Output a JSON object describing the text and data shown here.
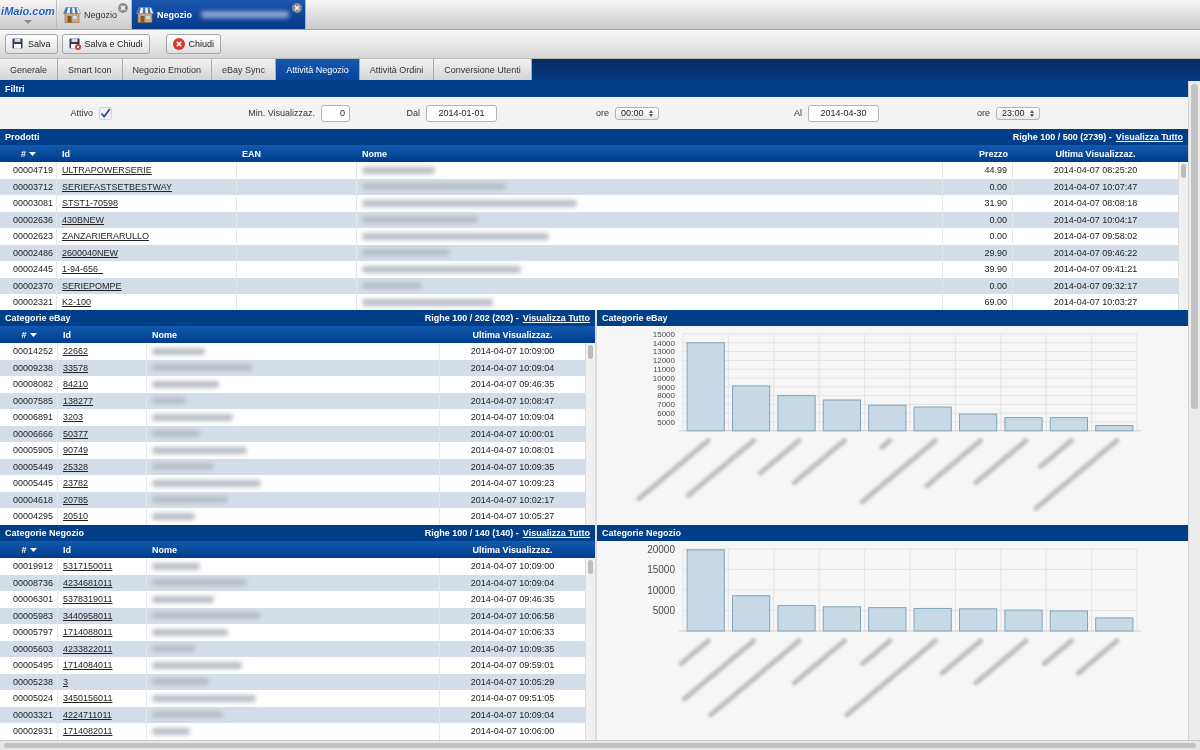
{
  "header": {
    "logo": "iMaio.com",
    "tabs": [
      {
        "label": "Negozio",
        "selected": false,
        "name_blurred": false
      },
      {
        "label": "Negozio",
        "selected": true,
        "name_blurred": true
      }
    ]
  },
  "toolbar": [
    {
      "label": "Salva",
      "kind": "save"
    },
    {
      "label": "Salva e Chiudi",
      "kind": "save_close"
    },
    {
      "label": "Chiudi",
      "kind": "close"
    }
  ],
  "tabs": [
    {
      "label": "Generale",
      "selected": false
    },
    {
      "label": "Smart Icon",
      "selected": false
    },
    {
      "label": "Negozio Emotion",
      "selected": false
    },
    {
      "label": "eBay Sync",
      "selected": false
    },
    {
      "label": "Attività Negozio",
      "selected": true
    },
    {
      "label": "Attività Ordini",
      "selected": false
    },
    {
      "label": "Conversione Utenti",
      "selected": false
    }
  ],
  "filters": {
    "title": "Filtri",
    "fields": [
      {
        "kind": "checkbox",
        "label": "Attivo",
        "checked": true
      },
      {
        "kind": "number",
        "label": "Min. Visualizzaz.",
        "value": "0"
      },
      {
        "kind": "date",
        "label": "Dal",
        "value": "2014-01-01"
      },
      {
        "kind": "select",
        "label": "ore",
        "value": "00:00"
      },
      {
        "kind": "date",
        "label": "Al",
        "value": "2014-04-30"
      },
      {
        "kind": "select",
        "label": "ore",
        "value": "23:00"
      }
    ]
  },
  "products": {
    "title": "Prodotti",
    "summary": "Righe 100 / 500 (2739) -",
    "show_all": "Visualizza Tutto",
    "columns": [
      {
        "label": "#",
        "kind": "number",
        "sorted": true
      },
      {
        "label": "Id",
        "kind": "id",
        "sorted": false
      },
      {
        "label": "EAN",
        "kind": "ean",
        "sorted": false
      },
      {
        "label": "Nome",
        "kind": "name",
        "sorted": false
      },
      {
        "label": "Prezzo",
        "kind": "price",
        "sorted": false
      },
      {
        "label": "Ultima Visualizzaz.",
        "kind": "date",
        "sorted": false
      }
    ],
    "rows": [
      {
        "number": "00004719",
        "id": "ULTRAPOWERSERIE",
        "price": "44.99",
        "last_view": "2014-04-07 08:25:20"
      },
      {
        "number": "00003712",
        "id": "SERIEFASTSETBESTWAY",
        "price": "0.00",
        "last_view": "2014-04-07 10:07:47"
      },
      {
        "number": "00003081",
        "id": "STST1-70598",
        "price": "31.90",
        "last_view": "2014-04-07 08:08:18"
      },
      {
        "number": "00002636",
        "id": "430BNEW",
        "price": "0.00",
        "last_view": "2014-04-07 10:04:17"
      },
      {
        "number": "00002623",
        "id": "ZANZARIERARULLO",
        "price": "0.00",
        "last_view": "2014-04-07 09:58:02"
      },
      {
        "number": "00002486",
        "id": "2600040NEW",
        "price": "29.90",
        "last_view": "2014-04-07 09:46:22"
      },
      {
        "number": "00002445",
        "id": "1-94-656_",
        "price": "39.90",
        "last_view": "2014-04-07 09:41:21"
      },
      {
        "number": "00002370",
        "id": "SERIEPOMPE",
        "price": "0.00",
        "last_view": "2014-04-07 09:32:17"
      },
      {
        "number": "00002321",
        "id": "K2-100",
        "price": "69.00",
        "last_view": "2014-04-07 10:03:27"
      }
    ]
  },
  "category_panels": [
    {
      "table": {
        "title": "Categorie eBay",
        "summary": "Righe 100 / 202 (202) -",
        "show_all": "Visualizza Tutto",
        "columns": [
          {
            "label": "#",
            "kind": "number",
            "sorted": true
          },
          {
            "label": "Id",
            "kind": "id",
            "sorted": false
          },
          {
            "label": "Nome",
            "kind": "name",
            "sorted": false
          },
          {
            "label": "Ultima Visualizzaz.",
            "kind": "date",
            "sorted": false
          }
        ],
        "rows": [
          {
            "number": "00014252",
            "id": "22662",
            "last_view": "2014-04-07 10:09:00"
          },
          {
            "number": "00009238",
            "id": "33578",
            "last_view": "2014-04-07 10:09:04"
          },
          {
            "number": "00008082",
            "id": "84210",
            "last_view": "2014-04-07 09:46:35"
          },
          {
            "number": "00007585",
            "id": "138277",
            "last_view": "2014-04-07 10:08:47"
          },
          {
            "number": "00006891",
            "id": "3203",
            "last_view": "2014-04-07 10:09:04"
          },
          {
            "number": "00006666",
            "id": "50377",
            "last_view": "2014-04-07 10:00:01"
          },
          {
            "number": "00005905",
            "id": "90749",
            "last_view": "2014-04-07 10:08:01"
          },
          {
            "number": "00005449",
            "id": "25328",
            "last_view": "2014-04-07 10:09:35"
          },
          {
            "number": "00005445",
            "id": "23782",
            "last_view": "2014-04-07 10:09:23"
          },
          {
            "number": "00004618",
            "id": "20785",
            "last_view": "2014-04-07 10:02:17"
          },
          {
            "number": "00004295",
            "id": "20510",
            "last_view": "2014-04-07 10:05:27"
          }
        ]
      },
      "chart": {
        "title": "Categorie eBay",
        "chart_data": {
          "type": "bar",
          "values": [
            14000,
            9100,
            8000,
            7500,
            6900,
            6700,
            5900,
            5500,
            5500,
            4600
          ],
          "ylim": [
            4000,
            15000
          ],
          "yticks": [
            5000,
            6000,
            7000,
            8000,
            9000,
            10000,
            11000,
            12000,
            13000,
            14000,
            15000
          ],
          "grid": true
        }
      }
    },
    {
      "table": {
        "title": "Categorie Negozio",
        "summary": "Righe 100 / 140 (140) -",
        "show_all": "Visualizza Tutto",
        "columns": [
          {
            "label": "#",
            "kind": "number",
            "sorted": true
          },
          {
            "label": "Id",
            "kind": "id",
            "sorted": false
          },
          {
            "label": "Nome",
            "kind": "name",
            "sorted": false
          },
          {
            "label": "Ultima Visualizzaz.",
            "kind": "date",
            "sorted": false
          }
        ],
        "rows": [
          {
            "number": "00019912",
            "id": "5317150011",
            "last_view": "2014-04-07 10:09:00"
          },
          {
            "number": "00008736",
            "id": "4234681011",
            "last_view": "2014-04-07 10:09:04"
          },
          {
            "number": "00006301",
            "id": "5378319011",
            "last_view": "2014-04-07 09:46:35"
          },
          {
            "number": "00005983",
            "id": "3440958011",
            "last_view": "2014-04-07 10:06:58"
          },
          {
            "number": "00005797",
            "id": "1714088011",
            "last_view": "2014-04-07 10:06:33"
          },
          {
            "number": "00005603",
            "id": "4233822011",
            "last_view": "2014-04-07 10:09:35"
          },
          {
            "number": "00005495",
            "id": "1714084011",
            "last_view": "2014-04-07 09:59:01"
          },
          {
            "number": "00005238",
            "id": "3",
            "last_view": "2014-04-07 10:05:29"
          },
          {
            "number": "00005024",
            "id": "3450156011",
            "last_view": "2014-04-07 09:51:05"
          },
          {
            "number": "00003321",
            "id": "4224711011",
            "last_view": "2014-04-07 10:09:04"
          },
          {
            "number": "00002931",
            "id": "1714082011",
            "last_view": "2014-04-07 10:06:00"
          }
        ]
      },
      "chart": {
        "title": "Categorie Negozio",
        "chart_data": {
          "type": "bar",
          "values": [
            19800,
            8600,
            6200,
            5900,
            5700,
            5500,
            5400,
            5100,
            4900,
            3200
          ],
          "ylim": [
            0,
            20000
          ],
          "yticks": [
            5000,
            10000,
            15000,
            20000
          ],
          "grid": true
        }
      }
    }
  ]
}
